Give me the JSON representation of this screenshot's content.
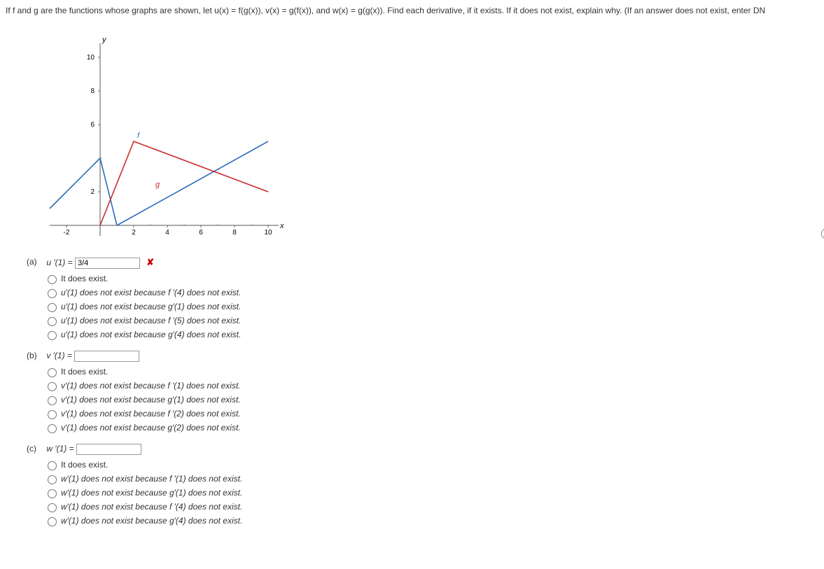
{
  "problem_text": "If f and g are the functions whose graphs are shown, let u(x) = f(g(x)), v(x) = g(f(x)), and w(x) = g(g(x)). Find each derivative, if it exists. If it does not exist, explain why. (If an answer does not exist, enter DN",
  "chart_data": {
    "type": "line",
    "xlabel": "x",
    "ylabel": "y",
    "xlim": [
      -3,
      11
    ],
    "ylim": [
      -1,
      11
    ],
    "xticks": [
      -2,
      2,
      4,
      6,
      8,
      10
    ],
    "yticks": [
      2,
      6,
      8,
      10
    ],
    "series": [
      {
        "name": "f",
        "color": "#2a6dbf",
        "points": [
          [
            -3,
            1
          ],
          [
            0,
            4
          ],
          [
            1,
            0
          ],
          [
            10,
            5
          ]
        ]
      },
      {
        "name": "g",
        "color": "#cc2b2b",
        "points": [
          [
            0,
            0
          ],
          [
            2,
            5
          ],
          [
            10,
            2
          ]
        ]
      }
    ],
    "labels": [
      {
        "text": "f",
        "x": 2.2,
        "y": 5.2,
        "color": "#2a6dbf"
      },
      {
        "text": "g",
        "x": 3.3,
        "y": 2.3,
        "color": "#cc2b2b"
      }
    ]
  },
  "parts": {
    "a": {
      "label": "(a)",
      "lhs": "u ′(1) =",
      "value": "3/4",
      "wrong": true,
      "options": [
        "It does exist.",
        "u′(1) does not exist because f ′(4) does not exist.",
        "u′(1) does not exist because g′(1) does not exist.",
        "u′(1) does not exist because f ′(5) does not exist.",
        "u′(1) does not exist because g′(4) does not exist."
      ]
    },
    "b": {
      "label": "(b)",
      "lhs": "v ′(1) =",
      "value": "",
      "wrong": false,
      "options": [
        "It does exist.",
        "v′(1) does not exist because f ′(1) does not exist.",
        "v′(1) does not exist because g′(1) does not exist.",
        "v′(1) does not exist because f ′(2) does not exist.",
        "v′(1) does not exist because g′(2) does not exist."
      ]
    },
    "c": {
      "label": "(c)",
      "lhs": "w ′(1) =",
      "value": "",
      "wrong": false,
      "options": [
        "It does exist.",
        "w′(1) does not exist because f ′(1) does not exist.",
        "w′(1) does not exist because g′(1) does not exist.",
        "w′(1) does not exist because f ′(4) does not exist.",
        "w′(1) does not exist because g′(4) does not exist."
      ]
    }
  }
}
